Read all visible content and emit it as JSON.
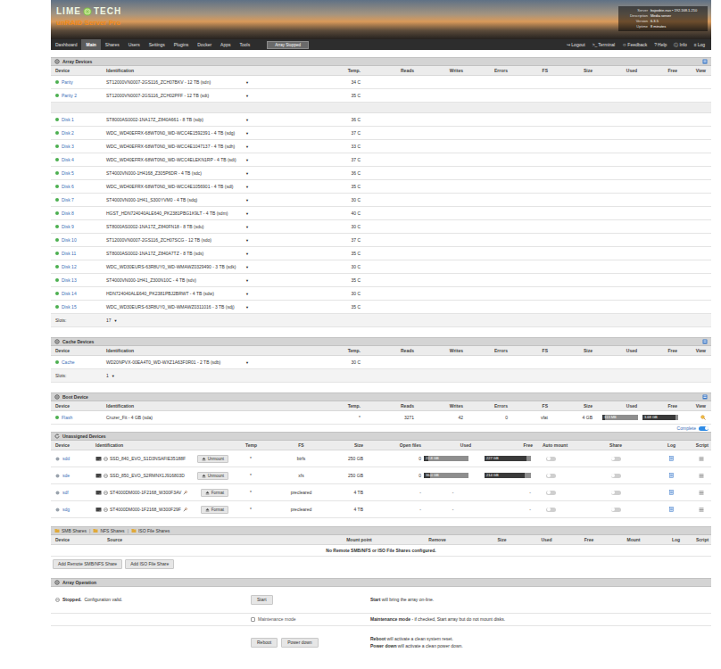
{
  "header": {
    "logo_left": "LIME",
    "logo_right": "TECH",
    "product": "unRAID Server Pro",
    "info": [
      {
        "label": "Server",
        "value": "bajoobie-nas • 192.168.1.210"
      },
      {
        "label": "Description",
        "value": "Media server"
      },
      {
        "label": "Version",
        "value": "6.3.5"
      },
      {
        "label": "Uptime",
        "value": "8 minutes"
      }
    ]
  },
  "nav": {
    "items": [
      {
        "label": "Dashboard",
        "selected": false
      },
      {
        "label": "Main",
        "selected": true
      },
      {
        "label": "Shares",
        "selected": false
      },
      {
        "label": "Users",
        "selected": false
      },
      {
        "label": "Settings",
        "selected": false
      },
      {
        "label": "Plugins",
        "selected": false
      },
      {
        "label": "Docker",
        "selected": false
      },
      {
        "label": "Apps",
        "selected": false
      },
      {
        "label": "Tools",
        "selected": false
      }
    ],
    "status": "Array Stopped",
    "actions": [
      {
        "icon": "↪",
        "label": "Logout"
      },
      {
        "icon": ">_",
        "label": "Terminal"
      },
      {
        "icon": "☺",
        "label": "Feedback"
      },
      {
        "icon": "?",
        "label": "Help"
      },
      {
        "icon": "ⓘ",
        "label": "Info"
      },
      {
        "icon": "≡",
        "label": "Log"
      }
    ]
  },
  "array": {
    "title": "Array Devices",
    "select_arrow": "▼",
    "columns": [
      "Device",
      "Identification",
      "Temp.",
      "Reads",
      "Writes",
      "Errors",
      "FS",
      "Size",
      "Used",
      "Free",
      "View"
    ],
    "parity": [
      {
        "device": "Parity",
        "id": "ST12000VN0007-2GS116_ZCH07BKV - 12 TB (sdn)",
        "temp": "34 C",
        "online": true
      },
      {
        "device": "Parity 2",
        "id": "ST12000VN0007-2GS116_ZCH02PFF - 12 TB (sdt)",
        "temp": "35 C",
        "online": true
      }
    ],
    "disks": [
      {
        "device": "Disk 1",
        "id": "ST8000AS0002-1NA17Z_Z840A661 - 8 TB (sdp)",
        "temp": "36 C",
        "online": true
      },
      {
        "device": "Disk 2",
        "id": "WDC_WD40EFRX-68WT0N0_WD-WCC4E1592391 - 4 TB (sdg)",
        "temp": "37 C",
        "online": true
      },
      {
        "device": "Disk 3",
        "id": "WDC_WD40EFRX-68WT0N0_WD-WCC4E1047137 - 4 TB (sdh)",
        "temp": "33 C",
        "online": true
      },
      {
        "device": "Disk 4",
        "id": "WDC_WD40EFRX-68WT0N0_WD-WCC4ELEKN1RP - 4 TB (sdi)",
        "temp": "37 C",
        "online": true
      },
      {
        "device": "Disk 5",
        "id": "ST4000VN000-1H4168_Z305P6DR - 4 TB (sdc)",
        "temp": "36 C",
        "online": true
      },
      {
        "device": "Disk 6",
        "id": "WDC_WD40EFRX-68WT0N0_WD-WCC4E1056901 - 4 TB (sdl)",
        "temp": "35 C",
        "online": true
      },
      {
        "device": "Disk 7",
        "id": "ST4000VN000-1H41_S300YVM0 - 4 TB (sdq)",
        "temp": "30 C",
        "online": true
      },
      {
        "device": "Disk 8",
        "id": "HGST_HDN724040ALE640_PK2381PBG1K9LT - 4 TB (sdm)",
        "temp": "40 C",
        "online": true
      },
      {
        "device": "Disk 9",
        "id": "ST8000AS0002-1NA17Z_Z840FN18 - 8 TB (sdu)",
        "temp": "30 C",
        "online": true
      },
      {
        "device": "Disk 10",
        "id": "ST12000VN0007-2GS116_ZCH07SCG - 12 TB (sdo)",
        "temp": "37 C",
        "online": true
      },
      {
        "device": "Disk 11",
        "id": "ST8000AS0002-1NA17Z_Z840A7TZ - 8 TB (sds)",
        "temp": "35 C",
        "online": true
      },
      {
        "device": "Disk 12",
        "id": "WDC_WD30EURS-63R8UY0_WD-WMAWZ0329490 - 3 TB (sdk)",
        "temp": "30 C",
        "online": true
      },
      {
        "device": "Disk 13",
        "id": "ST4000VN000-1H41_Z300N10C - 4 TB (sdv)",
        "temp": "35 C",
        "online": true
      },
      {
        "device": "Disk 14",
        "id": "HDN724040ALE640_PK2381PBJ2BRWT - 4 TB (sdw)",
        "temp": "30 C",
        "online": true
      },
      {
        "device": "Disk 15",
        "id": "WDC_WD30EURS-63R8UY0_WD-WMAWZ0311016 - 3 TB (sdj)",
        "temp": "35 C",
        "online": true
      }
    ],
    "slots": {
      "label": "Slots:",
      "value": "17"
    }
  },
  "cache": {
    "title": "Cache Devices",
    "select_arrow": "▼",
    "columns": [
      "Device",
      "Identification",
      "Temp.",
      "Reads",
      "Writes",
      "Errors",
      "FS",
      "Size",
      "Used",
      "Free",
      "View"
    ],
    "rows": [
      {
        "device": "Cache",
        "id": "WD20NPVX-00EA4T0_WD-WXZ1A63F0R01 - 2 TB (sdb)",
        "temp": "30 C",
        "online": true
      }
    ],
    "slots": {
      "label": "Slots:",
      "value": "1"
    }
  },
  "boot": {
    "title": "Boot Device",
    "columns": [
      "Device",
      "Identification",
      "Temp.",
      "Reads",
      "Writes",
      "Errors",
      "FS",
      "Size",
      "Used",
      "Free",
      "View"
    ],
    "row": {
      "device": "Flash",
      "id": "Cruzer_Fit - 4 GB (sda)",
      "temp": "*",
      "reads": "3271",
      "writes": "42",
      "errors": "0",
      "fs": "vfat",
      "size": "4 GB",
      "online": true,
      "used": {
        "text": "313 MB",
        "level": 0.08
      },
      "free": {
        "text": "3.68 GB",
        "level": 0.92
      }
    }
  },
  "complete": {
    "label": "Complete",
    "on": true
  },
  "unassigned": {
    "title": "Unassigned Devices",
    "columns": [
      "Device",
      "Identification",
      "Temp",
      "FS",
      "Size",
      "Open files",
      "Used",
      "Free",
      "Auto mount",
      "Share",
      "Log",
      "Script"
    ],
    "rows": [
      {
        "kind": "mounted",
        "device": "sdd",
        "id": "SSD_840_EVO_S1D3NSAFIE35188F",
        "button": "Unmount",
        "temp": "*",
        "fs": "btrfs",
        "size": "250 GB",
        "open_files": "0",
        "used": {
          "text": "22.8 GB",
          "level": 0.09
        },
        "free": {
          "text": "227 GB",
          "level": 0.91
        },
        "auto_mount": false,
        "share": false
      },
      {
        "kind": "mounted",
        "device": "sde",
        "id": "SSD_850_EVO_S2RMNX1J916803D",
        "button": "Unmount",
        "temp": "*",
        "fs": "xfs",
        "size": "250 GB",
        "open_files": "0",
        "used": {
          "text": "36.0 GB",
          "level": 0.14
        },
        "free": {
          "text": "214 GB",
          "level": 0.86
        },
        "auto_mount": false,
        "share": false
      },
      {
        "kind": "unmounted",
        "device": "sdf",
        "id": "ST4000DM000-1F2168_W300F3AV",
        "button": "Format",
        "temp": "*",
        "fs": "precleared",
        "size": "4 TB",
        "open_files": "-",
        "used": {
          "text": "-"
        },
        "free": {
          "text": "-"
        },
        "auto_mount": false,
        "share": false
      },
      {
        "kind": "unmounted",
        "device": "sdg",
        "id": "ST4000DM000-1F2168_W300F29F",
        "button": "Format",
        "temp": "*",
        "fs": "precleared",
        "size": "4 TB",
        "open_files": "-",
        "used": {
          "text": "-"
        },
        "free": {
          "text": "-"
        },
        "auto_mount": false,
        "share": false
      }
    ]
  },
  "shares": {
    "tabs": [
      "SMB Shares",
      "NFS Shares",
      "ISO File Shares"
    ],
    "separator": "|",
    "columns": [
      "Device",
      "Source",
      "Mount point",
      "Remove",
      "Size",
      "Used",
      "Free",
      "Mount",
      "Log",
      "Script"
    ],
    "empty": "No Remote SMB/NFS or ISO File Shares configured.",
    "buttons": [
      "Add Remote SMB/NFS Share",
      "Add ISO File Share"
    ]
  },
  "operation": {
    "title": "Array Operation",
    "status": {
      "bold": "Stopped.",
      "rest": " Configuration valid."
    },
    "start_button": "Start",
    "start_desc": {
      "bold": "Start",
      "rest": " will bring the array on-line."
    },
    "maintenance": {
      "label": "Maintenance mode",
      "checked": false
    },
    "maintenance_desc": {
      "bold": "Maintenance mode",
      "rest": " - if checked, Start array but do not mount disks."
    },
    "buttons": [
      "Reboot",
      "Power down"
    ],
    "reboot_desc": {
      "bold": "Reboot",
      "rest": " will activate a clean system reset."
    },
    "power_desc": {
      "bold": "Power down",
      "rest": " will activate a clean power down."
    }
  }
}
